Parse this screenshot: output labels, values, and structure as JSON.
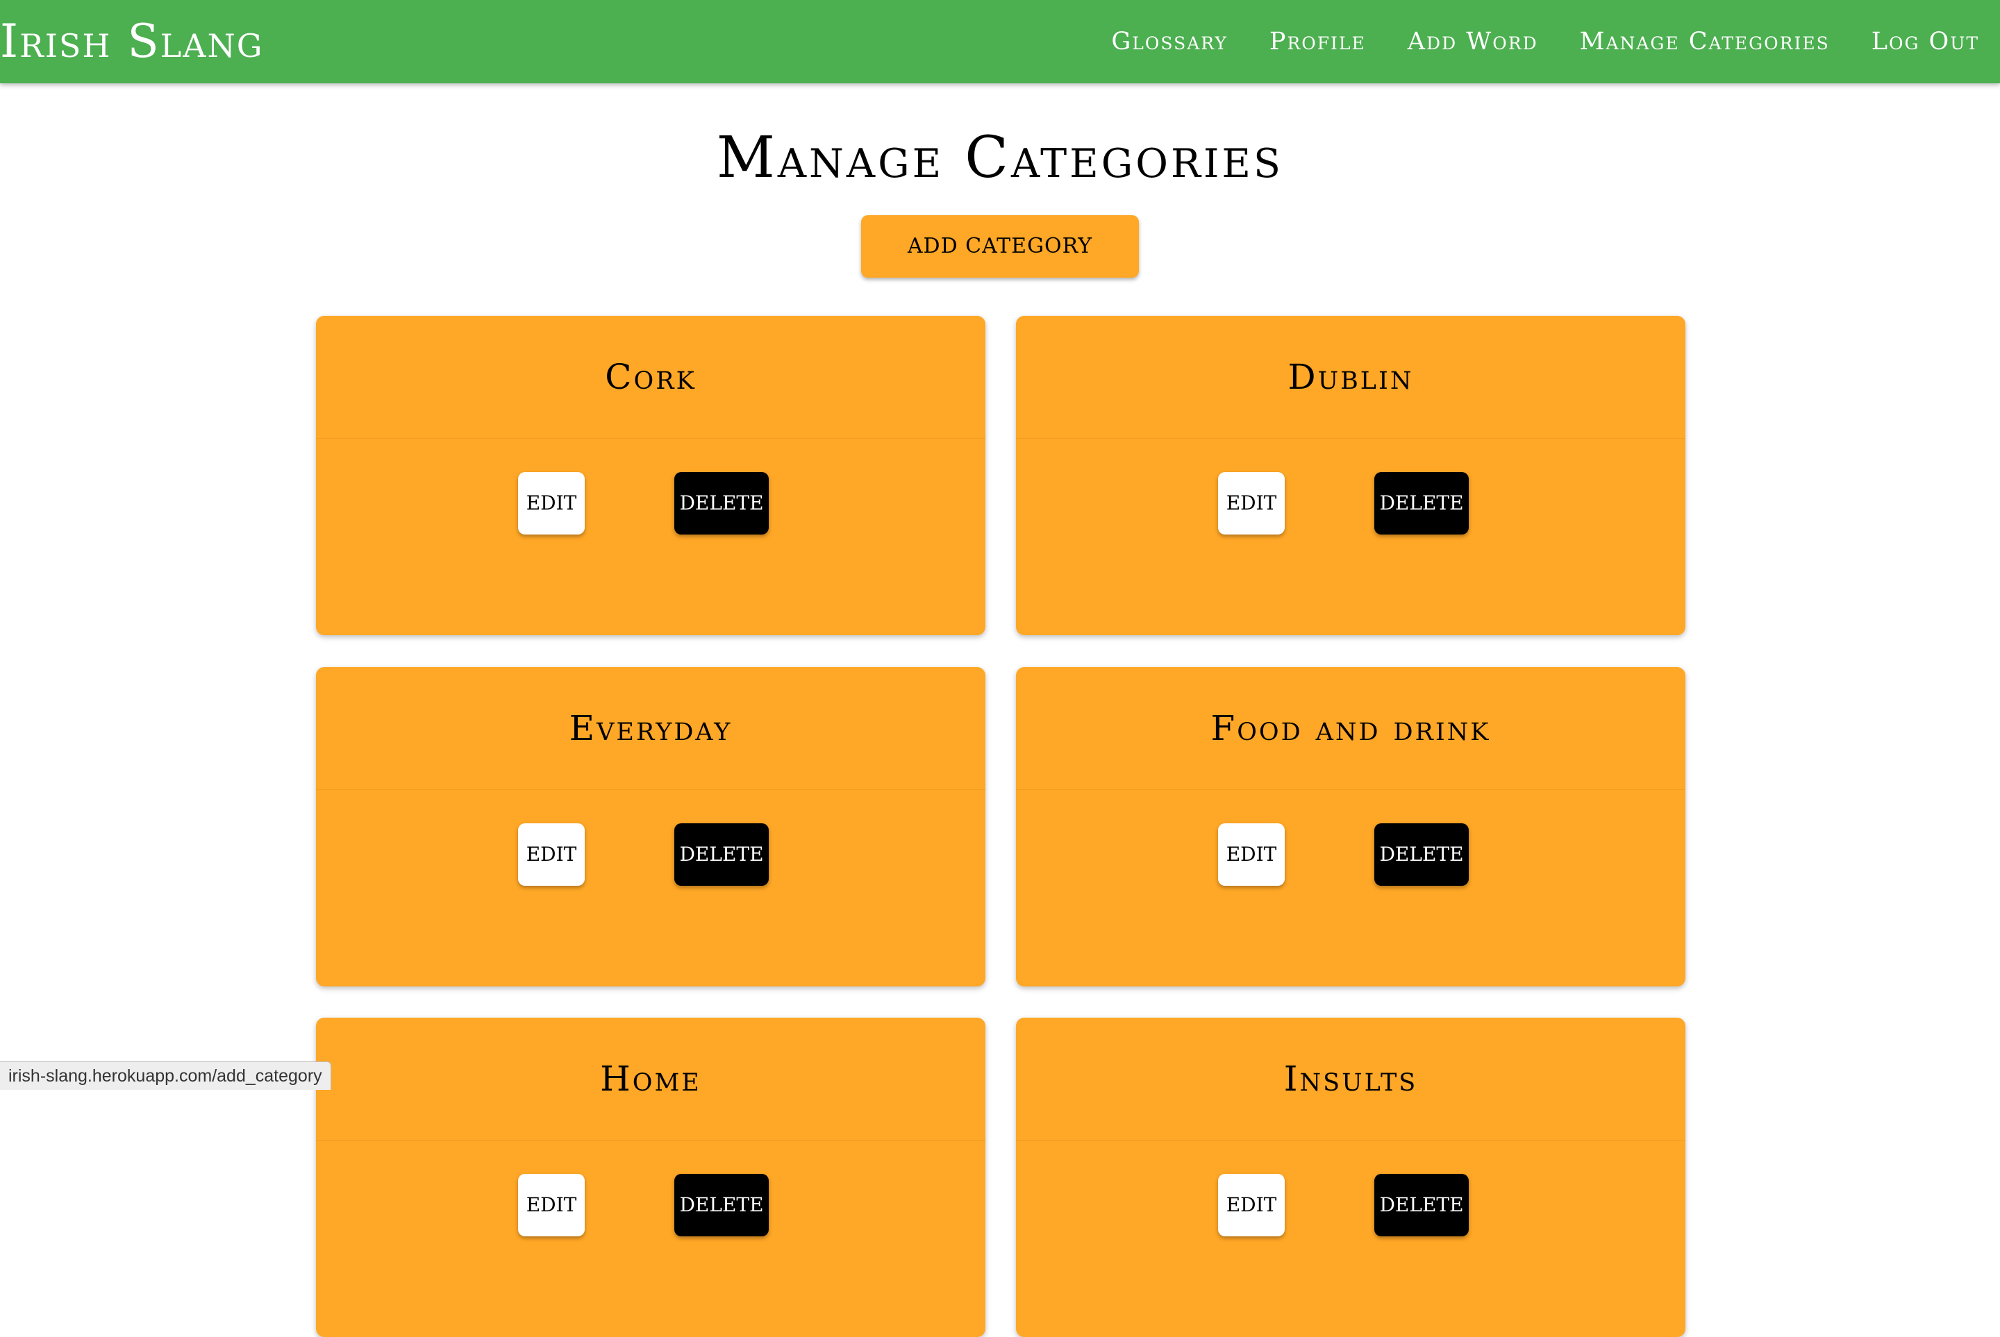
{
  "navbar": {
    "brand": "Irish Slang",
    "links": [
      "Glossary",
      "Profile",
      "Add Word",
      "Manage Categories",
      "Log Out"
    ]
  },
  "page": {
    "title": "Manage Categories",
    "add_button": "ADD CATEGORY"
  },
  "categories": [
    {
      "name": "Cork",
      "edit_label": "EDIT",
      "delete_label": "DELETE"
    },
    {
      "name": "Dublin",
      "edit_label": "EDIT",
      "delete_label": "DELETE"
    },
    {
      "name": "Everyday",
      "edit_label": "EDIT",
      "delete_label": "DELETE"
    },
    {
      "name": "Food and drink",
      "edit_label": "EDIT",
      "delete_label": "DELETE"
    },
    {
      "name": "Home",
      "edit_label": "EDIT",
      "delete_label": "DELETE"
    },
    {
      "name": "Insults",
      "edit_label": "EDIT",
      "delete_label": "DELETE"
    }
  ],
  "status_bar": {
    "url": "irish-slang.herokuapp.com/add_category"
  },
  "colors": {
    "navbar": "#4caf50",
    "card": "#ffa726",
    "delete": "#000000",
    "edit": "#ffffff"
  }
}
